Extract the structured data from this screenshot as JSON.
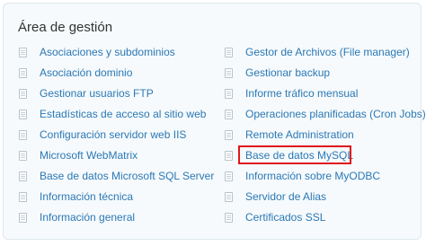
{
  "panel": {
    "title": "Área de gestión",
    "left_links": [
      {
        "label": "Asociaciones y subdominios",
        "icon": "document-icon"
      },
      {
        "label": "Asociación dominio",
        "icon": "document-icon"
      },
      {
        "label": "Gestionar usuarios FTP",
        "icon": "document-icon"
      },
      {
        "label": "Estadísticas de acceso al sitio web",
        "icon": "document-icon"
      },
      {
        "label": "Configuración servidor web IIS",
        "icon": "document-icon"
      },
      {
        "label": "Microsoft WebMatrix",
        "icon": "document-icon"
      },
      {
        "label": "Base de datos Microsoft SQL Server",
        "icon": "document-icon"
      },
      {
        "label": "Información técnica",
        "icon": "document-icon"
      },
      {
        "label": "Información general",
        "icon": "document-icon"
      }
    ],
    "right_links": [
      {
        "label": "Gestor de Archivos (File manager)",
        "icon": "document-icon"
      },
      {
        "label": "Gestionar backup",
        "icon": "document-icon"
      },
      {
        "label": "Informe tráfico mensual",
        "icon": "document-icon"
      },
      {
        "label": "Operaciones planificadas (Cron Jobs)",
        "icon": "document-icon"
      },
      {
        "label": "Remote Administration",
        "icon": "document-icon"
      },
      {
        "label": "Base de datos MySQL",
        "icon": "document-icon",
        "highlighted": true
      },
      {
        "label": "Información sobre MyODBC",
        "icon": "document-icon"
      },
      {
        "label": "Servidor de Alias",
        "icon": "document-icon"
      },
      {
        "label": "Certificados SSL",
        "icon": "document-icon"
      }
    ]
  },
  "colors": {
    "link": "#2b78b5",
    "panel_background": "#f6fafc",
    "panel_border": "#dfe8ee",
    "highlight_border": "#e0141b",
    "title": "#333333"
  }
}
